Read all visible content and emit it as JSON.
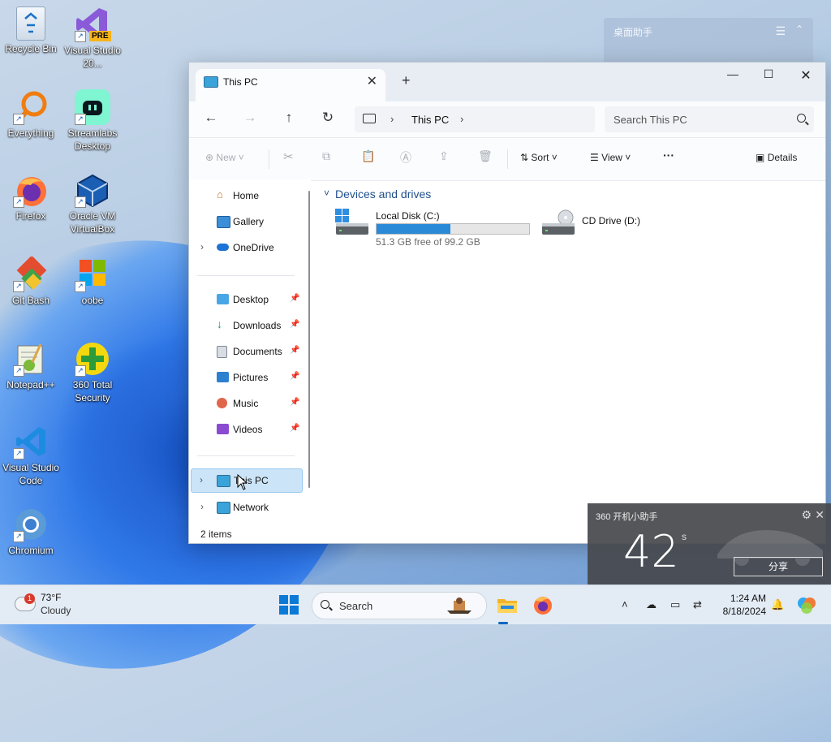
{
  "desktop": {
    "icons": [
      {
        "label": "Recycle Bin"
      },
      {
        "label": "Visual Studio 20...",
        "badge": "PRE"
      },
      {
        "label": "Everything"
      },
      {
        "label": "Streamlabs Desktop"
      },
      {
        "label": "Firefox"
      },
      {
        "label": "Oracle VM VirtualBox"
      },
      {
        "label": "Git Bash"
      },
      {
        "label": "oobe"
      },
      {
        "label": "Notepad++"
      },
      {
        "label": "360 Total Security"
      },
      {
        "label": "Visual Studio Code"
      },
      {
        "label": "Chromium"
      }
    ],
    "widget": {
      "title": "桌面助手"
    }
  },
  "explorer": {
    "tab_label": "This PC",
    "breadcrumb": "This PC",
    "search_placeholder": "Search This PC",
    "toolbar": {
      "new_label": "New",
      "sort_label": "Sort",
      "view_label": "View",
      "more_label": "···",
      "details_label": "Details"
    },
    "nav_items": [
      {
        "label": "Home"
      },
      {
        "label": "Gallery"
      },
      {
        "label": "OneDrive"
      },
      {
        "label": "Desktop"
      },
      {
        "label": "Downloads"
      },
      {
        "label": "Documents"
      },
      {
        "label": "Pictures"
      },
      {
        "label": "Music"
      },
      {
        "label": "Videos"
      },
      {
        "label": "This PC"
      },
      {
        "label": "Network"
      }
    ],
    "group_title": "Devices and drives",
    "drives": [
      {
        "name": "Local Disk (C:)",
        "free_text": "51.3 GB free of 99.2 GB",
        "used_fraction": 0.483
      },
      {
        "name": "CD Drive (D:)"
      }
    ],
    "status": "2 items"
  },
  "popup360": {
    "title": "360 开机小助手",
    "seconds": "42",
    "unit": "s",
    "share_label": "分享"
  },
  "taskbar": {
    "weather_temp": "73°F",
    "weather_cond": "Cloudy",
    "weather_badge": "1",
    "search_placeholder": "Search",
    "time": "1:24 AM",
    "date": "8/18/2024"
  },
  "colors": {
    "accent": "#0067c0",
    "drive_bar": "#2a8ad8",
    "selection": "#cce4f7"
  }
}
